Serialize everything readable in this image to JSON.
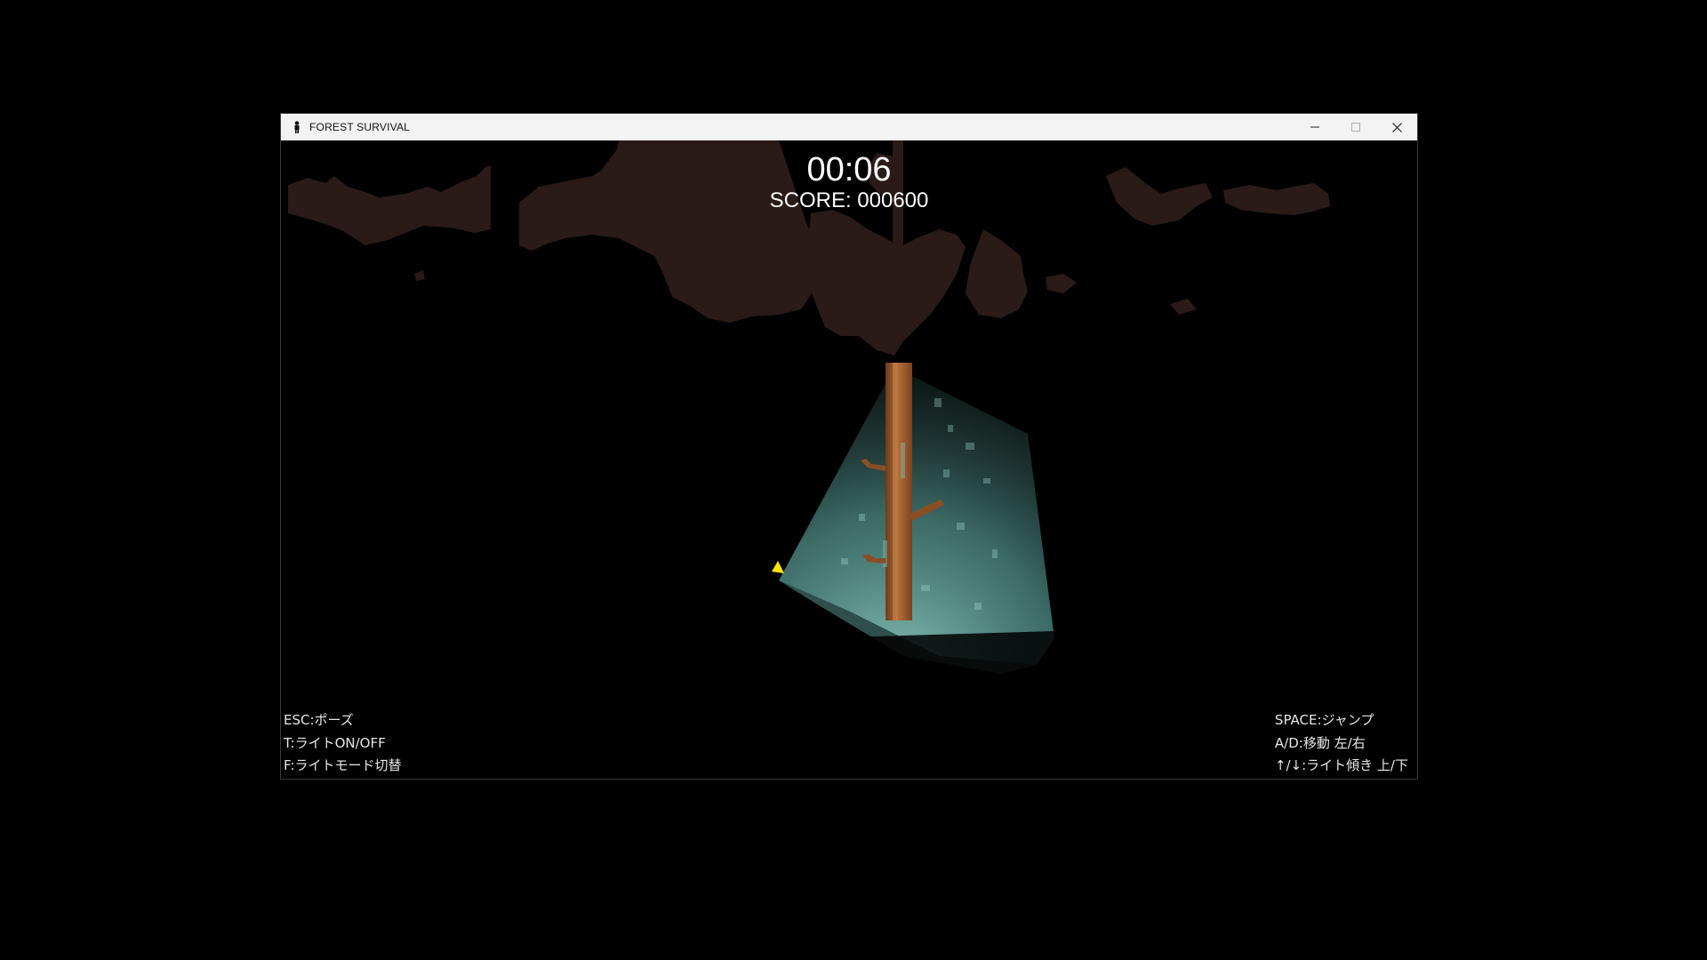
{
  "window": {
    "title": "FOREST SURVIVAL",
    "app_icon": "person-icon",
    "controls": [
      "minimize-icon",
      "maximize-icon",
      "close-icon"
    ]
  },
  "hud": {
    "time": "00:06",
    "score": "SCORE: 000600"
  },
  "help_left": [
    "ESC:ポーズ",
    "T:ライトON/OFF",
    "F:ライトモード切替"
  ],
  "help_right": [
    "SPACE:ジャンプ",
    "A/D:移動 左/右",
    "↑/↓:ライト傾き 上/下"
  ],
  "colors": {
    "canopy": "#2a1a18",
    "light_beam": "#7fbfb8",
    "trunk": "#9a5a2a",
    "player": "#ffe500",
    "titlebar": "#f3f3f3"
  }
}
